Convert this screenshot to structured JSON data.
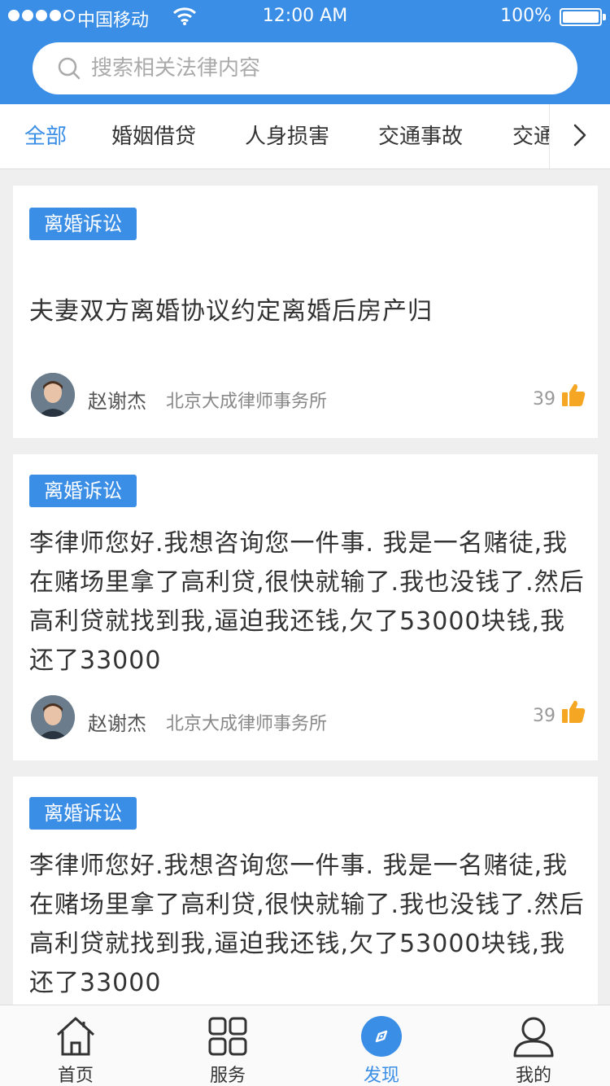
{
  "status": {
    "carrier": "中国移动",
    "time": "12:00 AM",
    "battery": "100%"
  },
  "search": {
    "placeholder": "搜索相关法律内容"
  },
  "tabs": [
    {
      "label": "全部",
      "active": true
    },
    {
      "label": "婚姻借贷"
    },
    {
      "label": "人身损害"
    },
    {
      "label": "交通事故"
    },
    {
      "label": "交通"
    }
  ],
  "posts": [
    {
      "tag": "离婚诉讼",
      "text": "夫妻双方离婚协议约定离婚后房产归",
      "author": "赵谢杰",
      "firm": "北京大成律师事务所",
      "likes": "39"
    },
    {
      "tag": "离婚诉讼",
      "text": "李律师您好.我想咨询您一件事. 我是一名赌徒,我在赌场里拿了高利贷,很快就输了.我也没钱了.然后高利贷就找到我,逼迫我还钱,欠了53000块钱,我还了33000",
      "author": "赵谢杰",
      "firm": "北京大成律师事务所",
      "likes": "39"
    },
    {
      "tag": "离婚诉讼",
      "text": "李律师您好.我想咨询您一件事. 我是一名赌徒,我在赌场里拿了高利贷,很快就输了.我也没钱了.然后高利贷就找到我,逼迫我还钱,欠了53000块钱,我还了33000"
    }
  ],
  "nav": [
    {
      "label": "首页",
      "icon": "home-icon"
    },
    {
      "label": "服务",
      "icon": "grid-icon"
    },
    {
      "label": "发现",
      "icon": "compass-icon",
      "active": true
    },
    {
      "label": "我的",
      "icon": "user-icon"
    }
  ],
  "colors": {
    "accent": "#3a8ee6",
    "like": "#f5a623"
  }
}
